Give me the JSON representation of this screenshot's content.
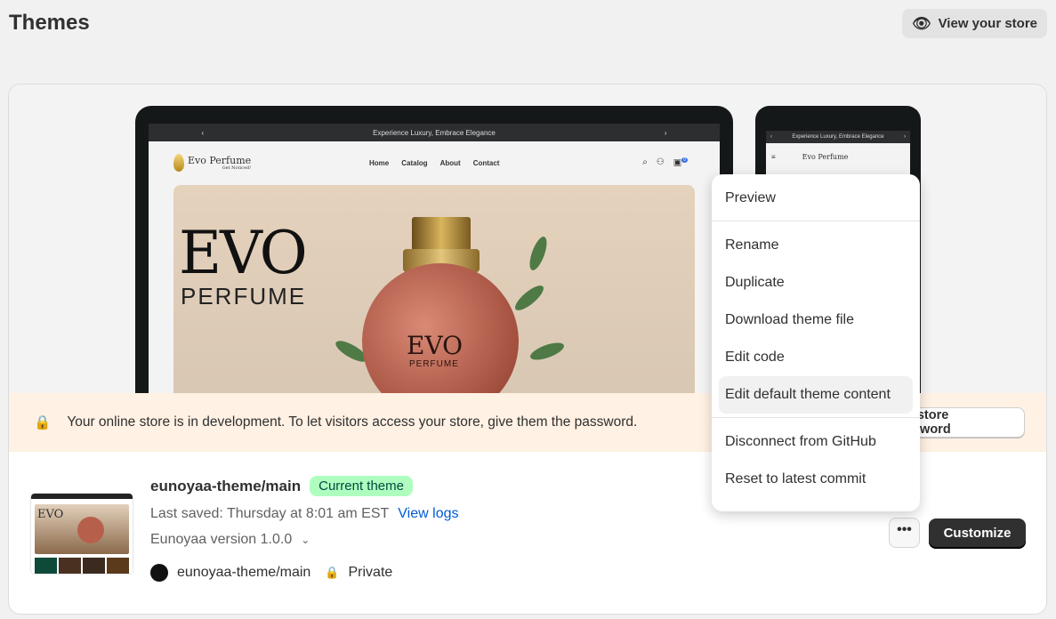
{
  "header": {
    "title": "Themes",
    "view_store": "View your store"
  },
  "preview": {
    "announcement": "Experience Luxury, Embrace Elegance",
    "brand": "Evo Perfume",
    "tagline": "Get Noticed!",
    "nav": [
      "Home",
      "Catalog",
      "About",
      "Contact"
    ],
    "cart_count": "0",
    "hero_title": "EVO",
    "hero_subtitle": "PERFUME",
    "bottle_title": "EVO",
    "bottle_subtitle": "PERFUME"
  },
  "alert": {
    "text": "Your online store is in development. To let visitors access your store, give them the password.",
    "button": "See store password"
  },
  "theme": {
    "name": "eunoyaa-theme/main",
    "badge": "Current theme",
    "last_saved": "Last saved: Thursday at 8:01 am EST",
    "view_logs": "View logs",
    "version": "Eunoyaa version 1.0.0",
    "repo": "eunoyaa-theme/main",
    "visibility": "Private"
  },
  "actions": {
    "more": "•••",
    "customize": "Customize"
  },
  "menu": {
    "items": [
      "Preview",
      "Rename",
      "Duplicate",
      "Download theme file",
      "Edit code",
      "Edit default theme content",
      "Disconnect from GitHub",
      "Reset to latest commit"
    ]
  }
}
